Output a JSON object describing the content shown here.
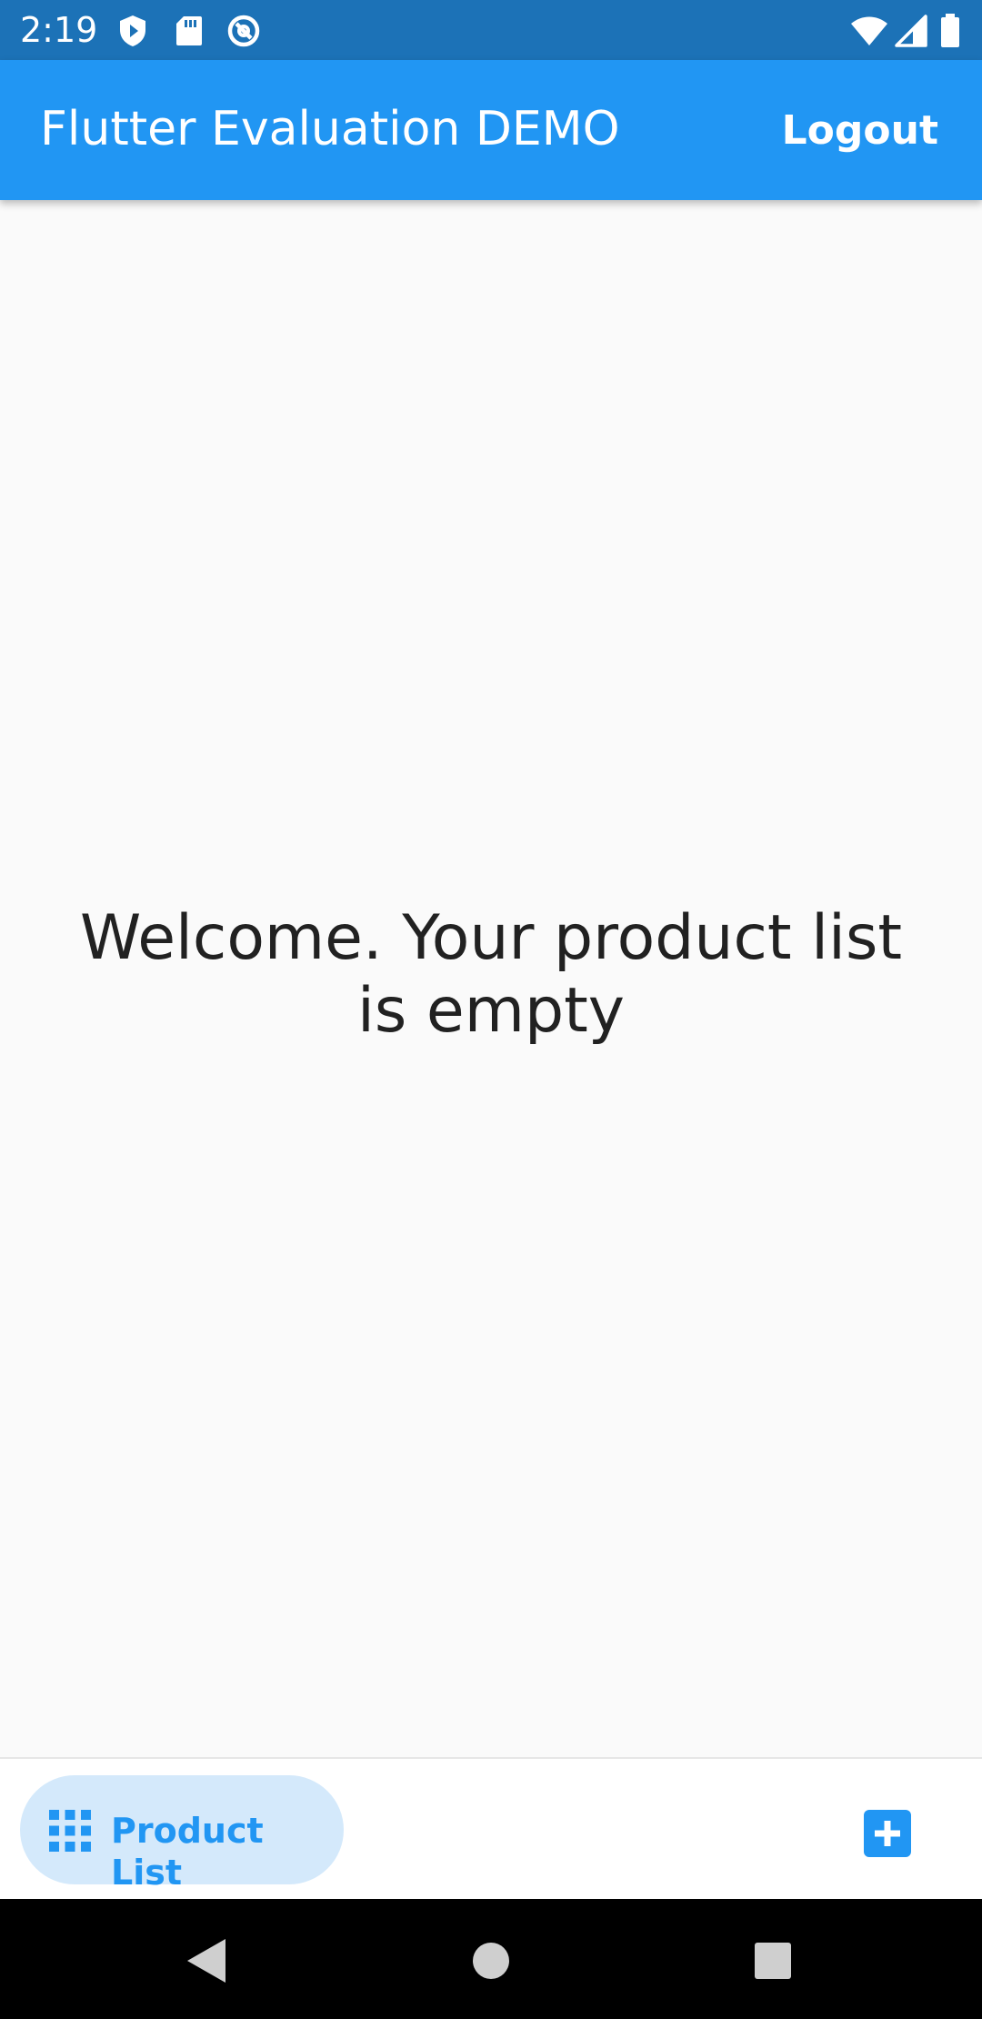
{
  "status_bar": {
    "time": "2:19",
    "icons": [
      "shield-play-icon",
      "sd-card-icon",
      "at-sign-icon",
      "wifi-icon",
      "signal-icon",
      "battery-icon"
    ],
    "background_color": "#1c72b7"
  },
  "app_bar": {
    "title": "Flutter Evaluation DEMO",
    "logout_label": "Logout",
    "background_color": "#2196f3"
  },
  "main": {
    "empty_message": "Welcome. Your product list is empty"
  },
  "bottom_nav": {
    "items": [
      {
        "label": "Product List",
        "icon": "grid-icon",
        "selected": true
      },
      {
        "label": "",
        "icon": "add-box-icon",
        "selected": false
      }
    ],
    "accent_color": "#2196f3",
    "pill_color": "#d4e9fb"
  },
  "system_nav": {
    "buttons": [
      "back-icon",
      "home-icon",
      "recents-icon"
    ]
  }
}
